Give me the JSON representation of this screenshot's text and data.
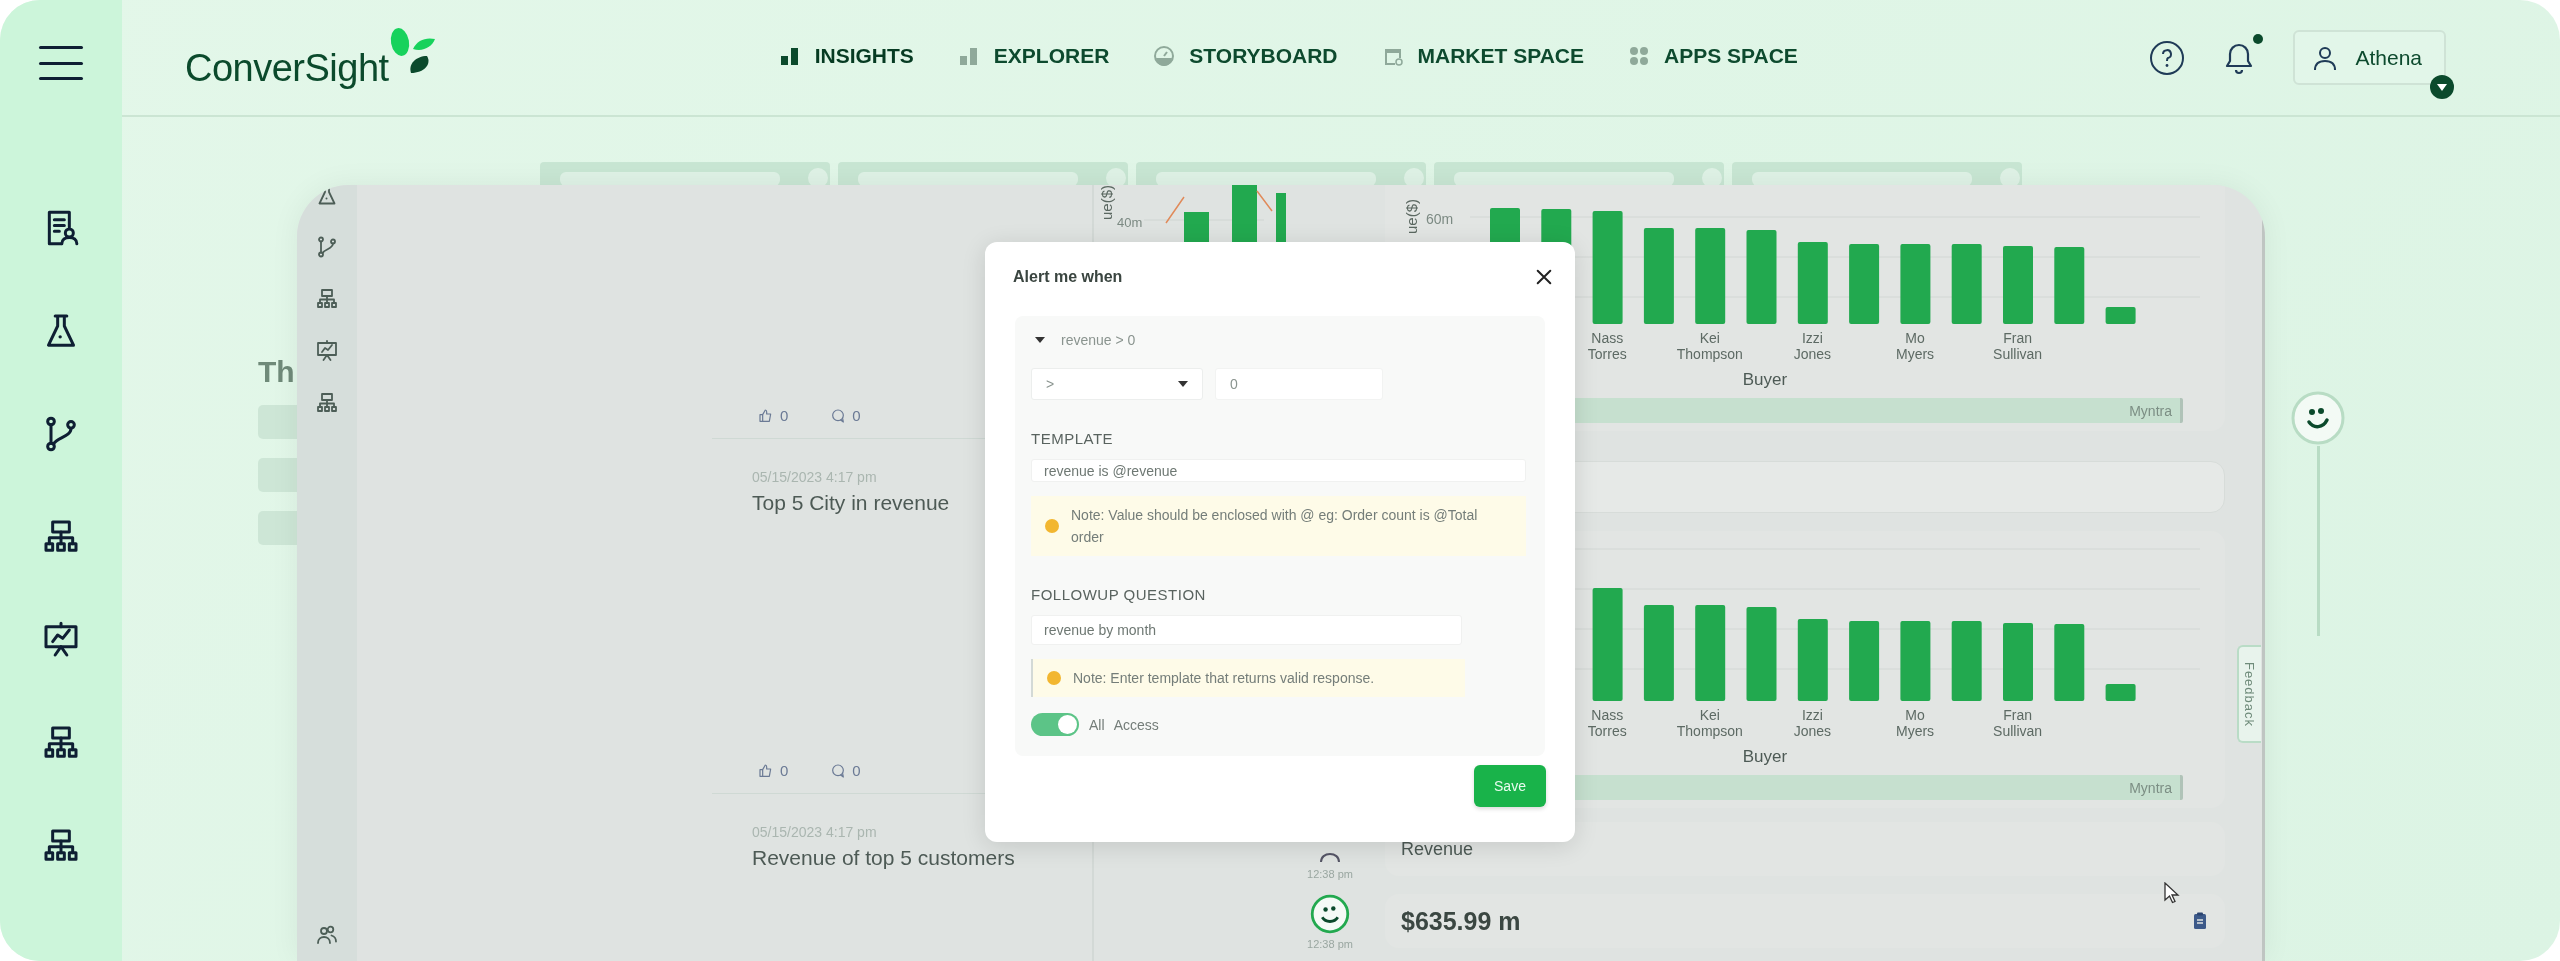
{
  "header": {
    "logo": "ConverSight",
    "nav": [
      {
        "label": "INSIGHTS",
        "selected": true
      },
      {
        "label": "EXPLORER",
        "selected": false
      },
      {
        "label": "STORYBOARD",
        "selected": false
      },
      {
        "label": "MARKET SPACE",
        "selected": false
      },
      {
        "label": "APPS SPACE",
        "selected": false
      }
    ],
    "notifications": {
      "unread": true
    },
    "user": {
      "name": "Athena"
    }
  },
  "background": {
    "heading": "Th"
  },
  "preview": {
    "feed": [
      {
        "likes": "0",
        "comments": "0",
        "date": "05/15/2023 4:17 pm",
        "title": "Top 5 City in revenue"
      },
      {
        "likes": "0",
        "comments": "0",
        "date": "05/15/2023 4:17 pm",
        "title": "Revenue of top 5 customers"
      }
    ],
    "mini_chart": {
      "y_label": "ue($)",
      "y_tick": "40m"
    },
    "charts": [
      {
        "y_label": "ue($)",
        "y_tick": "60m",
        "x_labels": [
          "Nass Torres",
          "Kei Thompson",
          "Izzi Jones",
          "Mo Myers",
          "Fran Sullivan"
        ],
        "x_title": "Buyer",
        "range_label": "Myntra"
      },
      {
        "x_labels": [
          "Nass Torres",
          "Kei Thompson",
          "Izzi Jones",
          "Mo Myers",
          "Fran Sullivan"
        ],
        "x_title": "Buyer",
        "range_label": "Myntra"
      }
    ],
    "messages": [
      {
        "kind": "user",
        "time": "12:38 pm",
        "text": "Revenue"
      },
      {
        "kind": "bot",
        "time": "12:38 pm",
        "text": "$635.99 m"
      }
    ],
    "feedback": "Feedback"
  },
  "modal": {
    "title": "Alert me when",
    "condition": {
      "summary": "revenue > 0",
      "expanded": true,
      "operator": ">",
      "value": "0"
    },
    "template_label": "TEMPLATE",
    "template": "revenue is @revenue",
    "template_note": "Note: Value should be enclosed with @ eg: Order count is @Total order",
    "followup_label": "FOLLOWUP QUESTION",
    "followup": "revenue by month",
    "followup_note": "Note: Enter template that returns valid response.",
    "access": {
      "label": "All Access",
      "on": true
    },
    "save": "Save"
  }
}
